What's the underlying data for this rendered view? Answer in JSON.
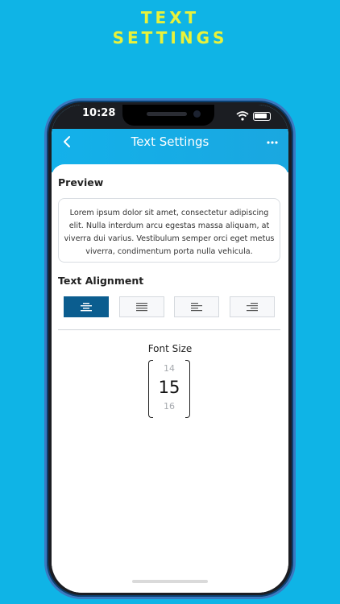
{
  "promo": {
    "line1": "TEXT",
    "line2": "SETTINGS"
  },
  "status": {
    "time": "10:28"
  },
  "nav": {
    "title": "Text Settings",
    "back_icon": "chevron-left-icon",
    "more_icon": "more-horizontal-icon"
  },
  "preview": {
    "label": "Preview",
    "text": "Lorem ipsum dolor sit amet, consectetur adipiscing elit. Nulla interdum arcu egestas massa aliquam, at viverra dui varius. Vestibulum semper orci eget metus viverra, condimentum porta nulla vehicula."
  },
  "alignment": {
    "label": "Text Alignment",
    "options": [
      {
        "name": "center",
        "icon": "align-center-icon",
        "active": true
      },
      {
        "name": "justify",
        "icon": "align-justify-icon",
        "active": false
      },
      {
        "name": "left",
        "icon": "align-left-icon",
        "active": false
      },
      {
        "name": "right",
        "icon": "align-right-icon",
        "active": false
      }
    ]
  },
  "font_size": {
    "label": "Font Size",
    "prev": "14",
    "current": "15",
    "next": "16"
  },
  "colors": {
    "background": "#0fb4e6",
    "promo_text": "#e9f23a",
    "accent": "#0b5d8f"
  }
}
